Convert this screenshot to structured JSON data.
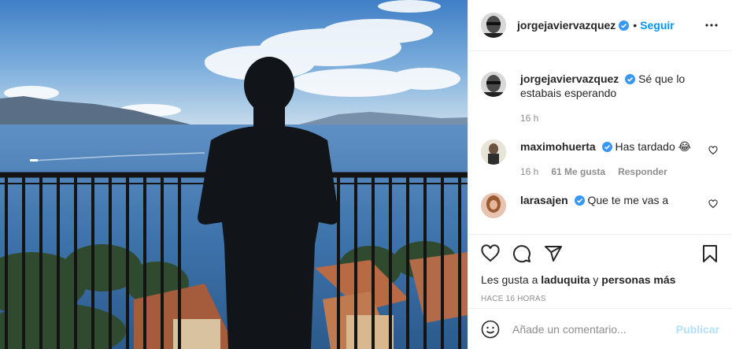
{
  "post": {
    "author": "jorgejaviervazquez",
    "follow_label": "Seguir",
    "dot": "•"
  },
  "comments": [
    {
      "user": "jorgejaviervazquez",
      "text": "Sé que lo estabais esperando",
      "time": "16 h"
    },
    {
      "user": "maximohuerta",
      "text": "Has tardado 😂",
      "time": "16 h",
      "likes": "61 Me gusta",
      "reply": "Responder"
    },
    {
      "user": "larasajen",
      "text": "Que te me vas a"
    }
  ],
  "likes": {
    "prefix": "Les gusta a",
    "user": "laduquita",
    "conj": "y",
    "rest": "personas más"
  },
  "timestamp": "HACE 16 HORAS",
  "add_comment": {
    "placeholder": "Añade un comentario...",
    "publish": "Publicar"
  },
  "colors": {
    "accent": "#0095f6",
    "verified": "#3897f0",
    "publish_disabled": "#b2dffc"
  }
}
